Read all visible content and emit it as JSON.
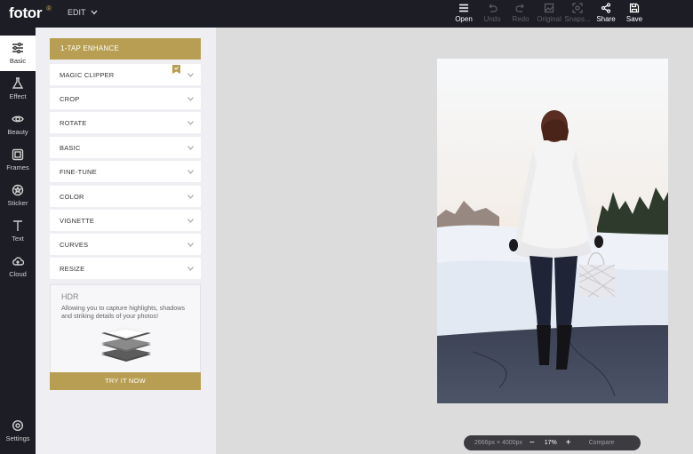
{
  "app": {
    "logo_text": "fotor",
    "logo_mark": "®",
    "edit_menu": "EDIT"
  },
  "toolbar": [
    {
      "label": "Open",
      "icon": "menu-icon",
      "enabled": true
    },
    {
      "label": "Undo",
      "icon": "undo-icon",
      "enabled": false
    },
    {
      "label": "Redo",
      "icon": "redo-icon",
      "enabled": false
    },
    {
      "label": "Original",
      "icon": "original-icon",
      "enabled": false
    },
    {
      "label": "Snaps...",
      "icon": "snapshot-icon",
      "enabled": false
    },
    {
      "label": "Share",
      "icon": "share-icon",
      "enabled": true
    },
    {
      "label": "Save",
      "icon": "save-icon",
      "enabled": true
    }
  ],
  "sidebar": {
    "items": [
      {
        "label": "Basic",
        "icon": "sliders-icon",
        "active": true
      },
      {
        "label": "Effect",
        "icon": "flask-icon",
        "active": false
      },
      {
        "label": "Beauty",
        "icon": "eye-icon",
        "active": false
      },
      {
        "label": "Frames",
        "icon": "frame-icon",
        "active": false
      },
      {
        "label": "Sticker",
        "icon": "sticker-icon",
        "active": false
      },
      {
        "label": "Text",
        "icon": "text-icon",
        "active": false
      },
      {
        "label": "Cloud",
        "icon": "cloud-icon",
        "active": false
      }
    ],
    "settings_label": "Settings"
  },
  "panel": {
    "enhance_label": "1-TAP ENHANCE",
    "sections": [
      "MAGIC CLIPPER",
      "CROP",
      "ROTATE",
      "BASIC",
      "FINE-TUNE",
      "COLOR",
      "VIGNETTE",
      "CURVES",
      "RESIZE"
    ],
    "hdr": {
      "title": "HDR",
      "description": "Allowing you to capture highlights, shadows and striking details of your photos!",
      "button_label": "TRY IT NOW"
    }
  },
  "zoom": {
    "dimensions": "2666px × 4000px",
    "minus": "−",
    "value": "17%",
    "plus": "+",
    "compare": "Compare"
  },
  "colors": {
    "accent": "#b89e52",
    "dark": "#1d1d26",
    "canvas": "#dcdcdc"
  }
}
